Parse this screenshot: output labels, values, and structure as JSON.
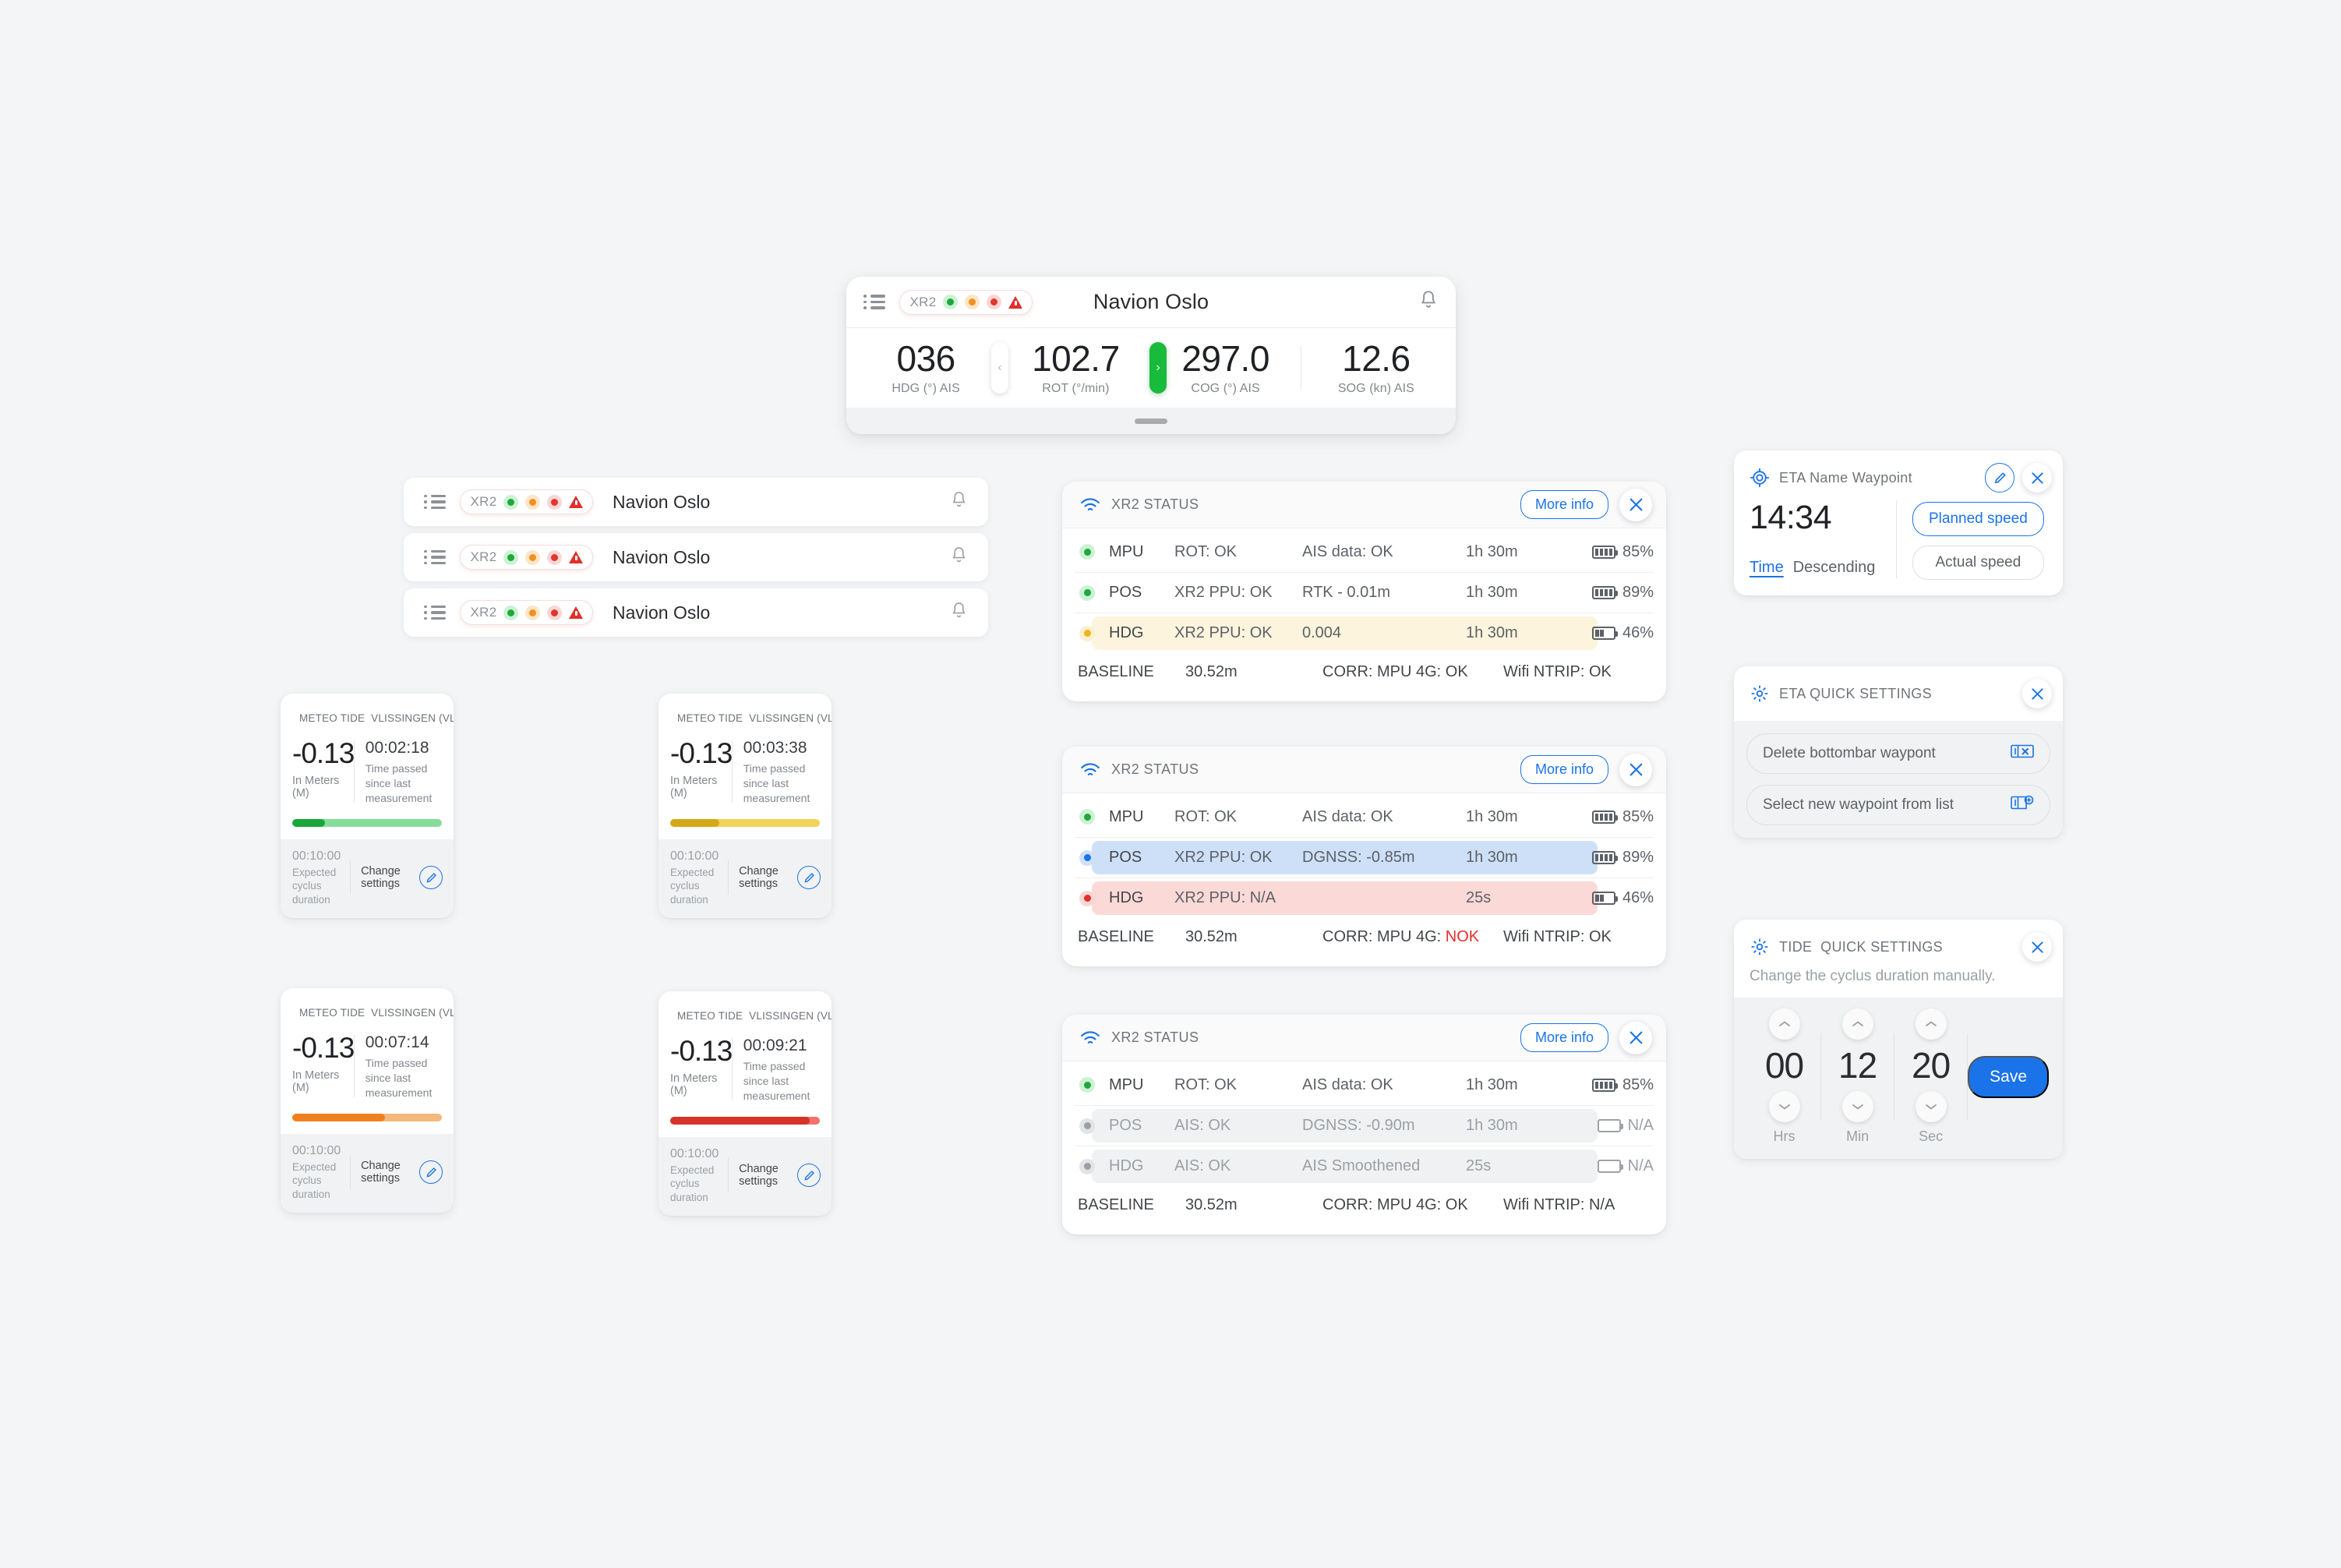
{
  "bottombar": {
    "vessel": "Navion Oslo",
    "badge_label": "XR2",
    "metrics": [
      {
        "value": "036",
        "label": "HDG (°) AIS"
      },
      {
        "value": "102.7",
        "label": "ROT (°/min)"
      },
      {
        "value": "297.0",
        "label": "COG (°) AIS"
      },
      {
        "value": "12.6",
        "label": "SOG (kn) AIS"
      }
    ],
    "prev_arrow": "‹",
    "next_arrow": "›"
  },
  "navrows": [
    {
      "badge_label": "XR2",
      "title": "Navion Oslo"
    },
    {
      "badge_label": "XR2",
      "title": "Navion Oslo"
    },
    {
      "badge_label": "XR2",
      "title": "Navion Oslo"
    }
  ],
  "status_cards": [
    {
      "title": "XR2 STATUS",
      "more_info": "More info",
      "rows": [
        {
          "status": "green",
          "name": "MPU",
          "a": "ROT: OK",
          "b": "AIS data: OK",
          "time": "1h 30m",
          "battery": "85%",
          "bars": 4,
          "highlight": "none"
        },
        {
          "status": "green",
          "name": "POS",
          "a": "XR2 PPU: OK",
          "b": "RTK - 0.01m",
          "time": "1h 30m",
          "battery": "89%",
          "bars": 4,
          "highlight": "none"
        },
        {
          "status": "yellow",
          "name": "HDG",
          "a": "XR2 PPU: OK",
          "b": "0.004",
          "time": "1h 30m",
          "battery": "46%",
          "bars": 2,
          "highlight": "yellow"
        }
      ],
      "baseline_label": "BASELINE",
      "baseline_value": "30.52m",
      "corr_label": "CORR: MPU 4G: ",
      "corr_value": "OK",
      "corr_nok": false,
      "ntrip": "Wifi NTRIP: OK"
    },
    {
      "title": "XR2 STATUS",
      "more_info": "More info",
      "rows": [
        {
          "status": "green",
          "name": "MPU",
          "a": "ROT: OK",
          "b": "AIS data: OK",
          "time": "1h 30m",
          "battery": "85%",
          "bars": 4,
          "highlight": "none"
        },
        {
          "status": "blue",
          "name": "POS",
          "a": "XR2 PPU: OK",
          "b": "DGNSS: -0.85m",
          "time": "1h 30m",
          "battery": "89%",
          "bars": 4,
          "highlight": "blue"
        },
        {
          "status": "red",
          "name": "HDG",
          "a": "XR2 PPU: N/A",
          "b": "",
          "time": "25s",
          "battery": "46%",
          "bars": 2,
          "highlight": "red"
        }
      ],
      "baseline_label": "BASELINE",
      "baseline_value": "30.52m",
      "corr_label": "CORR: MPU 4G: ",
      "corr_value": "NOK",
      "corr_nok": true,
      "ntrip": "Wifi NTRIP: OK"
    },
    {
      "title": "XR2 STATUS",
      "more_info": "More info",
      "rows": [
        {
          "status": "green",
          "name": "MPU",
          "a": "ROT: OK",
          "b": "AIS data: OK",
          "time": "1h 30m",
          "battery": "85%",
          "bars": 4,
          "highlight": "none"
        },
        {
          "status": "grey",
          "name": "POS",
          "a": "AIS: OK",
          "b": "DGNSS: -0.90m",
          "time": "1h 30m",
          "battery": "N/A",
          "bars": 0,
          "highlight": "grey"
        },
        {
          "status": "grey",
          "name": "HDG",
          "a": "AIS: OK",
          "b": "AIS Smoothened",
          "time": "25s",
          "battery": "N/A",
          "bars": 0,
          "highlight": "grey"
        }
      ],
      "baseline_label": "BASELINE",
      "baseline_value": "30.52m",
      "corr_label": "CORR: MPU 4G: ",
      "corr_value": "OK",
      "corr_nok": false,
      "ntrip": "Wifi NTRIP: N/A"
    }
  ],
  "tide_cards": [
    {
      "title_a": "METEO TIDE",
      "title_b": "VLISSINGEN (VLIS)",
      "value": "-0.13",
      "unit": "In Meters (M)",
      "elapsed": "00:02:18",
      "note": "Time passed since last measurement",
      "progress": 22,
      "color_fill": "#17a73b",
      "color_track": "#86dd99",
      "cycle": "00:10:00",
      "cycle_label": "Expected cyclus duration",
      "change_settings": "Change settings"
    },
    {
      "title_a": "METEO TIDE",
      "title_b": "VLISSINGEN (VLIS)",
      "value": "-0.13",
      "unit": "In Meters (M)",
      "elapsed": "00:03:38",
      "note": "Time passed since last measurement",
      "progress": 33,
      "color_fill": "#d4a917",
      "color_track": "#f0d358",
      "cycle": "00:10:00",
      "cycle_label": "Expected cyclus duration",
      "change_settings": "Change settings"
    },
    {
      "title_a": "METEO TIDE",
      "title_b": "VLISSINGEN (VLIS)",
      "value": "-0.13",
      "unit": "In Meters (M)",
      "elapsed": "00:07:14",
      "note": "Time passed since last measurement",
      "progress": 62,
      "color_fill": "#ef8020",
      "color_track": "#f5b87c",
      "cycle": "00:10:00",
      "cycle_label": "Expected cyclus duration",
      "change_settings": "Change settings"
    },
    {
      "title_a": "METEO TIDE",
      "title_b": "VLISSINGEN (VLIS)",
      "value": "-0.13",
      "unit": "In Meters (M)",
      "elapsed": "00:09:21",
      "note": "Time passed since last measurement",
      "progress": 93,
      "color_fill": "#d6332b",
      "color_track": "#f1736c",
      "cycle": "00:10:00",
      "cycle_label": "Expected cyclus duration",
      "change_settings": "Change settings"
    }
  ],
  "eta_panel": {
    "title": "ETA Name Waypoint",
    "time": "14:34",
    "sort_primary": "Time",
    "sort_order": "Descending",
    "speed_planned": "Planned speed",
    "speed_actual": "Actual speed",
    "speed_selected": "Planned speed"
  },
  "eta_quick_settings": {
    "title": "ETA QUICK SETTINGS",
    "items": [
      {
        "label": "Delete bottombar waypont",
        "icon": "waypoint-delete-icon"
      },
      {
        "label": "Select new waypoint from list",
        "icon": "waypoint-add-icon"
      }
    ]
  },
  "tide_quick_settings": {
    "title_a": "TIDE",
    "title_b": "QUICK SETTINGS",
    "subtitle": "Change the cyclus duration manually.",
    "spinners": [
      {
        "value": "00",
        "label": "Hrs"
      },
      {
        "value": "12",
        "label": "Min"
      },
      {
        "value": "20",
        "label": "Sec"
      }
    ],
    "save_label": "Save"
  },
  "colors": {
    "accent_blue": "#1a73e8",
    "green": "#1fa83c",
    "yellow": "#f0b31f",
    "red": "#e0302a",
    "grey": "#9ba0a6",
    "page_bg": "#f4f5f6"
  }
}
